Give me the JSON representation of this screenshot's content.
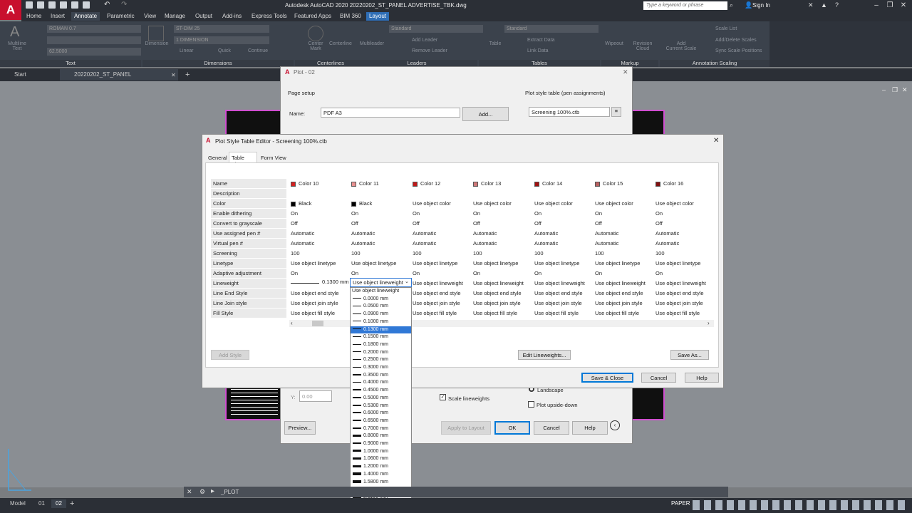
{
  "app": {
    "logo": "A",
    "title": "Autodesk AutoCAD 2020    20220202_ST_PANEL ADVERTISE_TBK.dwg",
    "search_placeholder": "Type a keyword or phrase",
    "sign_in": "Sign In"
  },
  "menu_tabs": [
    "Home",
    "Insert",
    "Annotate",
    "Parametric",
    "View",
    "Manage",
    "Output",
    "Add-ins",
    "Express Tools",
    "Featured Apps",
    "BIM 360",
    "Layout"
  ],
  "ribbon": {
    "text_style": "ROMAN 0.7",
    "text_height": "62.5000",
    "multiline_text": "Multiline\nText",
    "dim_style": "ST-DIM 25",
    "dim_layer": "1 DIMENSION",
    "dimension": "Dimension",
    "linear": "Linear",
    "quick": "Quick",
    "continue": "Continue",
    "center_mark": "Center\nMark",
    "centerline": "Centerline",
    "multileader": "Multileader",
    "leader_style": "Standard",
    "add_leader": "Add Leader",
    "remove_leader": "Remove Leader",
    "table": "Table",
    "table_style": "Standard",
    "extract_data": "Extract Data",
    "link_data": "Link Data",
    "wipeout": "Wipeout",
    "revision_cloud": "Revision\nCloud",
    "add_current_scale": "Add\nCurrent Scale",
    "scale_list": "Scale List",
    "add_delete_scales": "Add/Delete Scales",
    "sync_scale_positions": "Sync Scale Positions",
    "groups": [
      "Text",
      "Dimensions",
      "Centerlines",
      "Leaders",
      "Tables",
      "Markup",
      "Annotation Scaling"
    ]
  },
  "doc_tabs": [
    "Start",
    "20220202_ST_PANEL ADVERTISE_TBK*"
  ],
  "plot_dialog": {
    "title": "Plot - 02",
    "page_setup": "Page setup",
    "name_label": "Name:",
    "name_value": "PDF A3",
    "add_button": "Add...",
    "pst_label": "Plot style table (pen assignments)",
    "pst_value": "Screening 100%.ctb",
    "y_label": "Y:",
    "y_value": "0.00",
    "scale_lineweights": "Scale lineweights",
    "landscape": "Landscape",
    "upside_down": "Plot upside-down",
    "preview": "Preview...",
    "apply_to_layout": "Apply to Layout",
    "ok": "OK",
    "cancel": "Cancel",
    "help": "Help"
  },
  "pst_editor": {
    "title": "Plot Style Table Editor - Screening 100%.ctb",
    "tabs": [
      "General",
      "Table View",
      "Form View"
    ],
    "row_labels": [
      "Name",
      "Description",
      "Color",
      "Enable dithering",
      "Convert to grayscale",
      "Use assigned pen #",
      "Virtual pen #",
      "Screening",
      "Linetype",
      "Adaptive adjustment",
      "Lineweight",
      "Line End Style",
      "Line Join style",
      "Fill Style"
    ],
    "columns": [
      {
        "name": "Color 10",
        "swatch": "#d42020",
        "color": "Black",
        "color_swatch": "#000000",
        "dither": "On",
        "gray": "Off",
        "pen": "Automatic",
        "vpen": "Automatic",
        "screening": "100",
        "linetype": "Use object linetype",
        "adaptive": "On",
        "lineweight": "0.1300 mm",
        "end": "Use object end style",
        "join": "Use object join style",
        "fill": "Use object fill style"
      },
      {
        "name": "Color 11",
        "swatch": "#e89090",
        "color": "Black",
        "color_swatch": "#000000",
        "dither": "On",
        "gray": "Off",
        "pen": "Automatic",
        "vpen": "Automatic",
        "screening": "100",
        "linetype": "Use object linetype",
        "adaptive": "On",
        "lineweight": "Use object lineweight",
        "end": "Use object end style",
        "join": "Use object join style",
        "fill": "Use object fill style"
      },
      {
        "name": "Color 12",
        "swatch": "#c01818",
        "color": "Use object color",
        "color_swatch": "",
        "dither": "On",
        "gray": "Off",
        "pen": "Automatic",
        "vpen": "Automatic",
        "screening": "100",
        "linetype": "Use object linetype",
        "adaptive": "On",
        "lineweight": "Use object lineweight",
        "end": "Use object end style",
        "join": "Use object join style",
        "fill": "Use object fill style"
      },
      {
        "name": "Color 13",
        "swatch": "#d07878",
        "color": "Use object color",
        "color_swatch": "",
        "dither": "On",
        "gray": "Off",
        "pen": "Automatic",
        "vpen": "Automatic",
        "screening": "100",
        "linetype": "Use object linetype",
        "adaptive": "On",
        "lineweight": "Use object lineweight",
        "end": "Use object end style",
        "join": "Use object join style",
        "fill": "Use object fill style"
      },
      {
        "name": "Color 14",
        "swatch": "#a01010",
        "color": "Use object color",
        "color_swatch": "",
        "dither": "On",
        "gray": "Off",
        "pen": "Automatic",
        "vpen": "Automatic",
        "screening": "100",
        "linetype": "Use object linetype",
        "adaptive": "On",
        "lineweight": "Use object lineweight",
        "end": "Use object end style",
        "join": "Use object join style",
        "fill": "Use object fill style"
      },
      {
        "name": "Color 15",
        "swatch": "#b86060",
        "color": "Use object color",
        "color_swatch": "",
        "dither": "On",
        "gray": "Off",
        "pen": "Automatic",
        "vpen": "Automatic",
        "screening": "100",
        "linetype": "Use object linetype",
        "adaptive": "On",
        "lineweight": "Use object lineweight",
        "end": "Use object end style",
        "join": "Use object join style",
        "fill": "Use object fill style"
      },
      {
        "name": "Color 16",
        "swatch": "#801010",
        "color": "Use object color",
        "color_swatch": "",
        "dither": "On",
        "gray": "Off",
        "pen": "Automatic",
        "vpen": "Automatic",
        "screening": "100",
        "linetype": "Use object linetype",
        "adaptive": "On",
        "lineweight": "Use object lineweight",
        "end": "Use object end style",
        "join": "Use object join style",
        "fill": "Use object fill style"
      }
    ],
    "lineweight_dropdown": {
      "selected": "0.1300 mm",
      "options": [
        "Use object lineweight",
        "0.0000 mm",
        "0.0500 mm",
        "0.0900 mm",
        "0.1000 mm",
        "0.1300 mm",
        "0.1500 mm",
        "0.1800 mm",
        "0.2000 mm",
        "0.2500 mm",
        "0.3000 mm",
        "0.3500 mm",
        "0.4000 mm",
        "0.4500 mm",
        "0.5000 mm",
        "0.5300 mm",
        "0.6000 mm",
        "0.6500 mm",
        "0.7000 mm",
        "0.8000 mm",
        "0.9000 mm",
        "1.0000 mm",
        "1.0600 mm",
        "1.2000 mm",
        "1.4000 mm",
        "1.5800 mm",
        "2.0000 mm",
        "2.1100 mm"
      ]
    },
    "add_style": "Add Style",
    "edit_lineweights": "Edit Lineweights...",
    "save_as": "Save As...",
    "save_close": "Save & Close",
    "cancel": "Cancel",
    "help": "Help"
  },
  "command_line": "_PLOT",
  "status": {
    "tabs": [
      "Model",
      "01",
      "02"
    ],
    "paper": "PAPER"
  }
}
